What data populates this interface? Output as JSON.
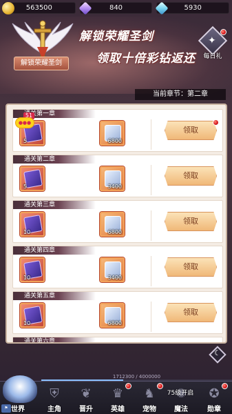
{
  "currency": {
    "gold": "563500",
    "gem_purple": "840",
    "gem_blue": "5930"
  },
  "banner": {
    "line1": "解锁荣耀圣剑",
    "line2": "领取十倍彩钻返还",
    "sword_title": "解锁荣耀圣剑",
    "daily_label": "每日礼"
  },
  "current_chapter": "当前章节：第二章",
  "level_badge": "51",
  "rewards": [
    {
      "chapter": "通关第一章",
      "item1_count": "5",
      "item2_count": "6800",
      "claim_label": "领取",
      "has_dot": true
    },
    {
      "chapter": "通关第二章",
      "item1_count": "5",
      "item2_count": "3400",
      "claim_label": "领取",
      "has_dot": false
    },
    {
      "chapter": "通关第三章",
      "item1_count": "10",
      "item2_count": "6800",
      "claim_label": "领取",
      "has_dot": false
    },
    {
      "chapter": "通关第四章",
      "item1_count": "10",
      "item2_count": "3400",
      "claim_label": "领取",
      "has_dot": false
    },
    {
      "chapter": "通关第五章",
      "item1_count": "10",
      "item2_count": "6800",
      "claim_label": "领取",
      "has_dot": false
    },
    {
      "chapter": "通关第六章",
      "item1_count": "",
      "item2_count": "",
      "claim_label": "",
      "has_dot": false
    }
  ],
  "exp": {
    "text": "1712300 / 4000000",
    "fraction": 0.428
  },
  "nav": {
    "world": "世界",
    "items": [
      "主角",
      "晋升",
      "英雄",
      "宠物",
      "魔法",
      "勋章"
    ],
    "unlock_tip": "75级开启"
  },
  "colors": {
    "accent_red": "#d5151a",
    "claim_bg": "#f0b878",
    "panel_bg": "#f4ece4"
  }
}
